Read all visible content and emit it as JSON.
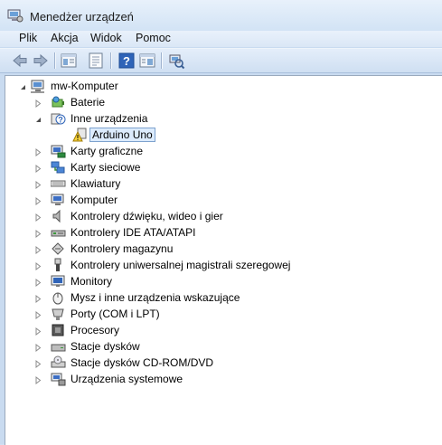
{
  "window": {
    "title": "Menedżer urządzeń"
  },
  "menu": [
    "Plik",
    "Akcja",
    "Widok",
    "Pomoc"
  ],
  "toolbar": {
    "buttons": [
      "back-icon",
      "forward-icon",
      "tree-view-icon",
      "properties-icon",
      "help-icon",
      "details-icon",
      "scan-hardware-icon"
    ]
  },
  "tree": {
    "root": "mw-Komputer",
    "items": [
      {
        "label": "Baterie",
        "icon": "battery-icon",
        "expanded": false
      },
      {
        "label": "Inne urządzenia",
        "icon": "unknown-device-icon",
        "expanded": true
      },
      {
        "label": "Arduino Uno",
        "icon": "warning-device-icon",
        "child": true,
        "selected": true
      },
      {
        "label": "Karty graficzne",
        "icon": "display-adapter-icon",
        "expanded": false
      },
      {
        "label": "Karty sieciowe",
        "icon": "network-adapter-icon",
        "expanded": false
      },
      {
        "label": "Klawiatury",
        "icon": "keyboard-icon",
        "expanded": false
      },
      {
        "label": "Komputer",
        "icon": "computer-icon",
        "expanded": false
      },
      {
        "label": "Kontrolery dźwięku, wideo i gier",
        "icon": "speaker-icon",
        "expanded": false
      },
      {
        "label": "Kontrolery IDE ATA/ATAPI",
        "icon": "ide-controller-icon",
        "expanded": false
      },
      {
        "label": "Kontrolery magazynu",
        "icon": "storage-controller-icon",
        "expanded": false
      },
      {
        "label": "Kontrolery uniwersalnej magistrali szeregowej",
        "icon": "usb-icon",
        "expanded": false
      },
      {
        "label": "Monitory",
        "icon": "monitor-icon",
        "expanded": false
      },
      {
        "label": "Mysz i inne urządzenia wskazujące",
        "icon": "mouse-icon",
        "expanded": false
      },
      {
        "label": "Porty (COM i LPT)",
        "icon": "port-icon",
        "expanded": false
      },
      {
        "label": "Procesory",
        "icon": "processor-icon",
        "expanded": false
      },
      {
        "label": "Stacje dysków",
        "icon": "disk-drive-icon",
        "expanded": false
      },
      {
        "label": "Stacje dysków CD-ROM/DVD",
        "icon": "cdrom-icon",
        "expanded": false
      },
      {
        "label": "Urządzenia systemowe",
        "icon": "system-devices-icon",
        "expanded": false
      }
    ]
  }
}
